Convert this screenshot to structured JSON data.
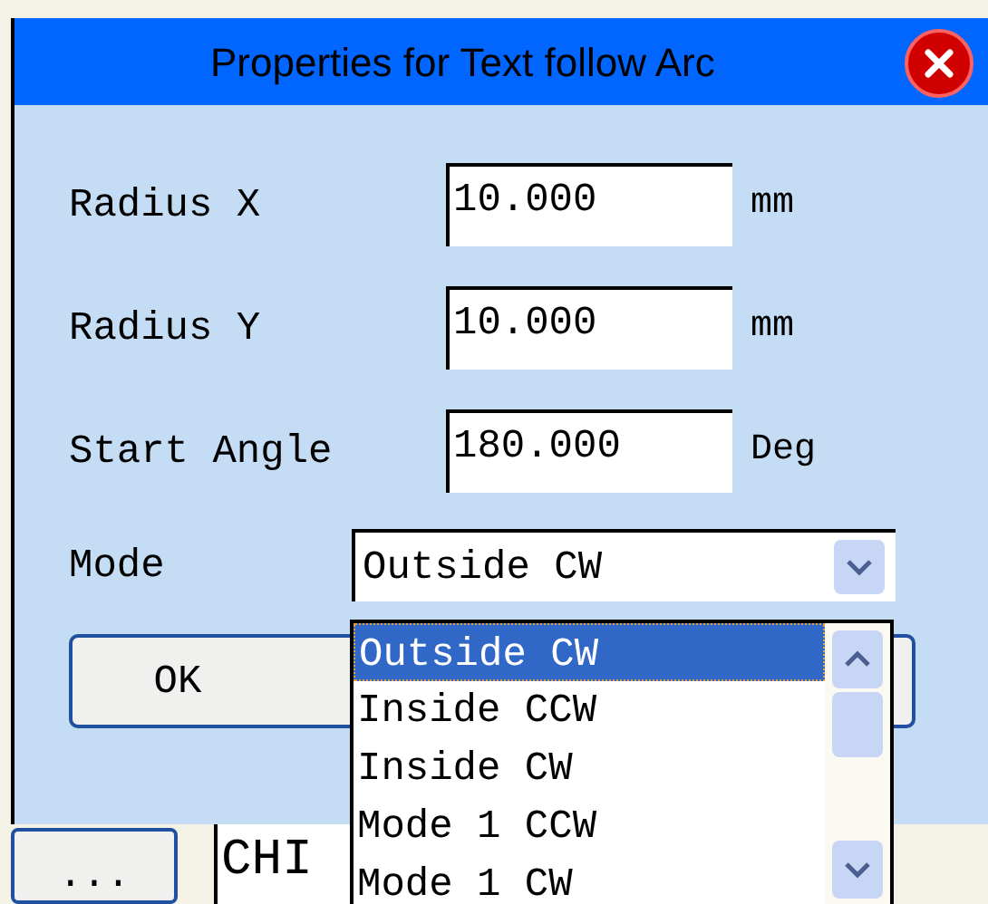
{
  "window": {
    "title": "Properties for Text follow Arc"
  },
  "fields": [
    {
      "label": "Radius X",
      "value": "10.000",
      "unit": "mm"
    },
    {
      "label": "Radius Y",
      "value": "10.000",
      "unit": "mm"
    },
    {
      "label": "Start Angle",
      "value": "180.000",
      "unit": "Deg"
    }
  ],
  "mode": {
    "label": "Mode",
    "value": "Outside CW",
    "expanded": true,
    "options": [
      {
        "label": "Outside CW",
        "selected": true
      },
      {
        "label": "Inside CCW",
        "selected": false
      },
      {
        "label": "Inside CW",
        "selected": false
      },
      {
        "label": "Mode 1 CCW",
        "selected": false
      },
      {
        "label": "Mode 1 CW",
        "selected": false
      }
    ]
  },
  "buttons": [
    "OK"
  ],
  "background_window": {
    "button": "...",
    "field_value": "CHI"
  }
}
